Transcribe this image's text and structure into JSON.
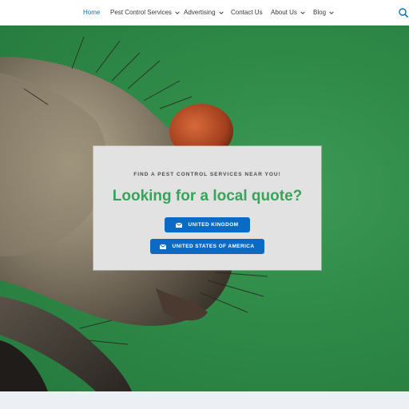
{
  "nav": {
    "items": [
      {
        "label": "Home",
        "active": true,
        "dropdown": false
      },
      {
        "label": "Pest Control Services",
        "active": false,
        "dropdown": true
      },
      {
        "label": "Advertising",
        "active": false,
        "dropdown": true
      },
      {
        "label": "Contact Us",
        "active": false,
        "dropdown": false
      },
      {
        "label": "About Us",
        "active": false,
        "dropdown": true
      },
      {
        "label": "Blog",
        "active": false,
        "dropdown": true
      }
    ],
    "search_icon": "search-icon"
  },
  "hero": {
    "background_color": "#2f8a48",
    "kicker": "FIND A PEST CONTROL SERVICES NEAR YOU!",
    "headline": "Looking for a local quote?",
    "headline_color": "#37a45a",
    "buttons": [
      {
        "label": "UNITED KINGDOM",
        "icon": "mail-icon"
      },
      {
        "label": "UNITED STATES OF AMERICA",
        "icon": "mail-icon"
      }
    ],
    "button_color": "#0b6bc4"
  },
  "colors": {
    "nav_active": "#0274be",
    "nav_text": "#3a3a3a",
    "card_bg": "#e2e2e2"
  }
}
